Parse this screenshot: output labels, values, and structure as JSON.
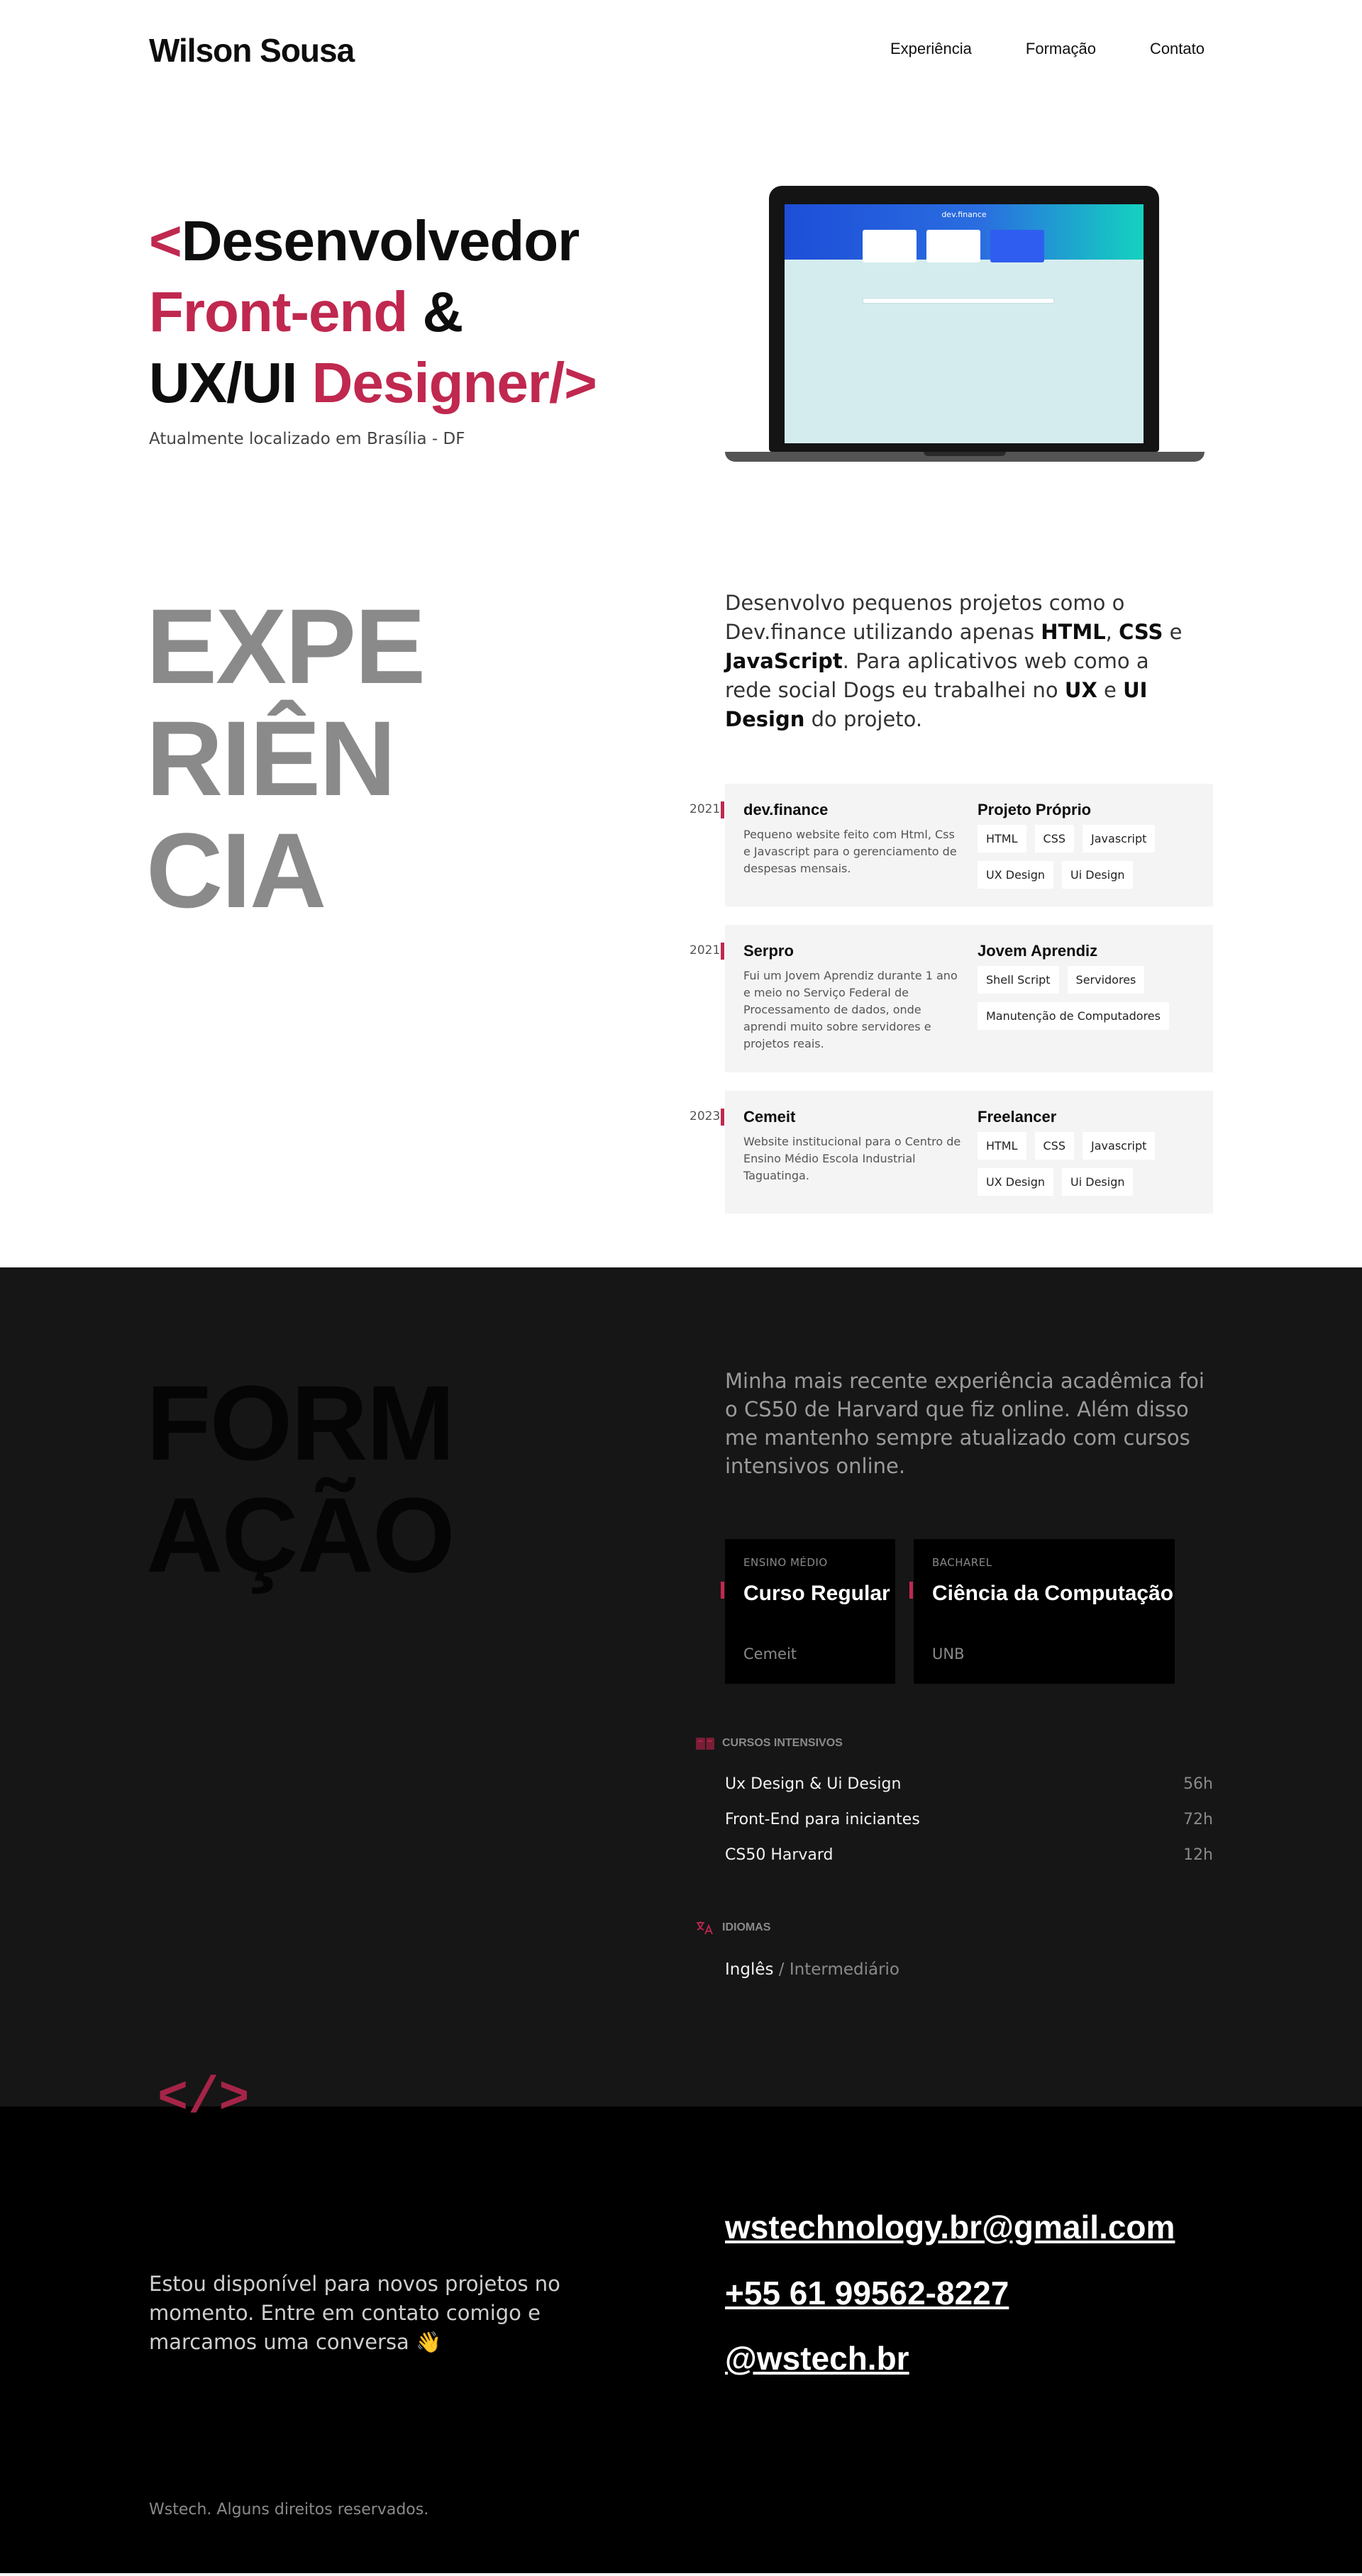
{
  "header": {
    "brand": "Wilson Sousa",
    "nav": [
      "Experiência",
      "Formação",
      "Contato"
    ]
  },
  "hero": {
    "line1_bracket": "<",
    "line1_text": "Desenvolvedor",
    "line2_accent": "Front-end",
    "line2_text": " &",
    "line3_text": "UX/UI ",
    "line3_accent": "Designer/>",
    "subtitle": "Atualmente localizado em Brasília - DF",
    "screen_title": "dev.finance"
  },
  "experience": {
    "big_title": [
      "EXPE",
      "RIÊN",
      "CIA"
    ],
    "intro": {
      "p1": "Desenvolvo pequenos projetos como o Dev.finance utilizando apenas ",
      "html": "HTML",
      "sep1": ", ",
      "css": "CSS",
      "sep2": " e ",
      "js": "JavaScript",
      "p2": ". Para aplicativos web como a rede social Dogs eu trabalhei no ",
      "ux": "UX",
      "sep3": " e ",
      "ui": "UI Design",
      "p3": " do projeto."
    },
    "jobs": [
      {
        "year": "2021",
        "name": "dev.finance",
        "desc": "Pequeno website feito com Html, Css e Javascript para o gerenciamento de despesas mensais.",
        "role": "Projeto Próprio",
        "tags": [
          "HTML",
          "CSS",
          "Javascript",
          "UX Design",
          "Ui Design"
        ]
      },
      {
        "year": "2021",
        "name": "Serpro",
        "desc": "Fui um Jovem Aprendiz durante 1 ano e meio no Serviço Federal de Processamento de dados, onde aprendi muito sobre servidores e projetos reais.",
        "role": "Jovem Aprendiz",
        "tags": [
          "Shell Script",
          "Servidores",
          "Manutenção de Computadores"
        ]
      },
      {
        "year": "2023",
        "name": "Cemeit",
        "desc": "Website institucional para o Centro de Ensino Médio Escola Industrial Taguatinga.",
        "role": "Freelancer",
        "tags": [
          "HTML",
          "CSS",
          "Javascript",
          "UX Design",
          "Ui Design"
        ]
      }
    ]
  },
  "education": {
    "big_title": [
      "FORM",
      "AÇÃO"
    ],
    "intro": "Minha mais recente experiência acadêmica foi o CS50 de Harvard que fiz online. Além disso me mantenho sempre atualizado com cursos intensivos online.",
    "courses": [
      {
        "level": "ENSINO MÉDIO",
        "title": "Curso Regular",
        "institution": "Cemeit"
      },
      {
        "level": "BACHAREL",
        "title": "Ciência da Computação",
        "institution": "UNB"
      }
    ],
    "intensive_label": "CURSOS INTENSIVOS",
    "intensive": [
      {
        "name": "Ux Design & Ui Design",
        "hours": "56h"
      },
      {
        "name": "Front-End para iniciantes",
        "hours": "72h"
      },
      {
        "name": "CS50 Harvard",
        "hours": "12h"
      }
    ],
    "languages_label": "IDIOMAS",
    "language": {
      "name": "Inglês",
      "sep": " / ",
      "level": "Intermediário"
    }
  },
  "footer": {
    "logo": "</>",
    "text": "Estou disponível para novos projetos no momento. Entre em contato comigo e marcamos uma conversa 👋",
    "email": "wstechnology.br@gmail.com",
    "phone": "+55 61 99562-8227",
    "social": "@wstech.br",
    "copyright": "Wstech. Alguns direitos reservados."
  },
  "colors": {
    "accent": "#c0284f",
    "dark_section": "#161616",
    "footer": "#000000"
  }
}
